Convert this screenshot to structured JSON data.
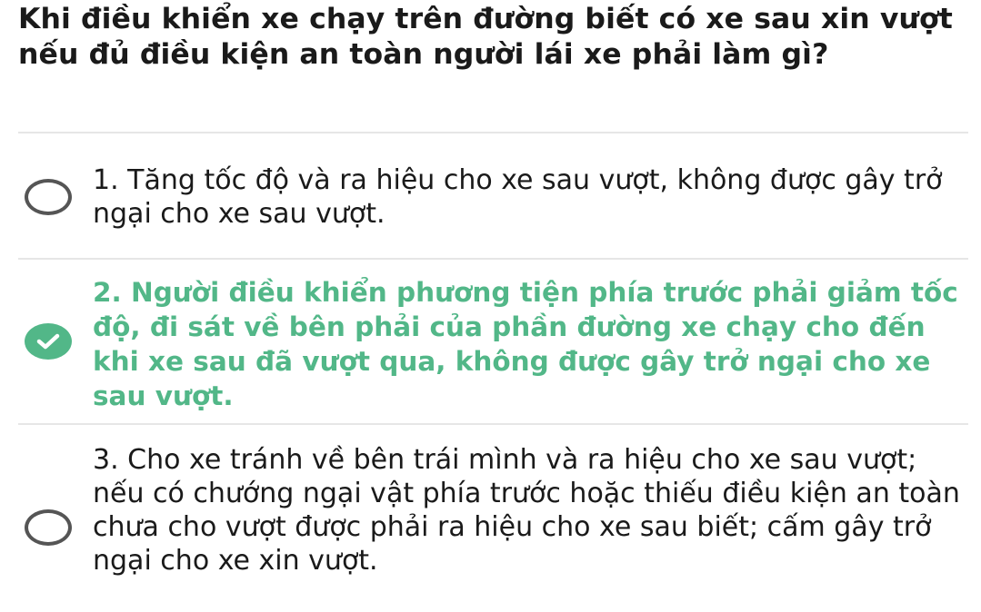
{
  "question": {
    "text": "Khi điều khiển xe chạy trên đường biết có xe sau xin vượt nếu đủ điều kiện an toàn người lái xe phải làm gì?"
  },
  "options": [
    {
      "text": "1. Tăng tốc độ và ra hiệu cho xe sau vượt, không được gây trở ngại cho xe sau vượt.",
      "state": "unselected",
      "icon": "radio-empty-icon"
    },
    {
      "text": "2. Người điều khiển phương tiện phía trước phải giảm tốc độ, đi sát về bên phải của phần đường xe chạy cho đến khi xe sau đã vượt qua, không được gây trở ngại cho xe sau vượt.",
      "state": "correct",
      "icon": "checkmark-icon"
    },
    {
      "text": "3. Cho xe tránh về bên trái mình và ra hiệu cho xe sau vượt; nếu có chướng ngại vật phía trước hoặc thiếu điều kiện an toàn chưa cho vượt được phải ra hiệu cho xe sau biết; cấm gây trở ngại cho xe xin vượt.",
      "state": "unselected",
      "icon": "radio-empty-icon"
    }
  ],
  "colors": {
    "correct": "#52b788",
    "text": "#1a1a1a",
    "radio_border": "#555555",
    "divider": "#e6e6e6"
  }
}
